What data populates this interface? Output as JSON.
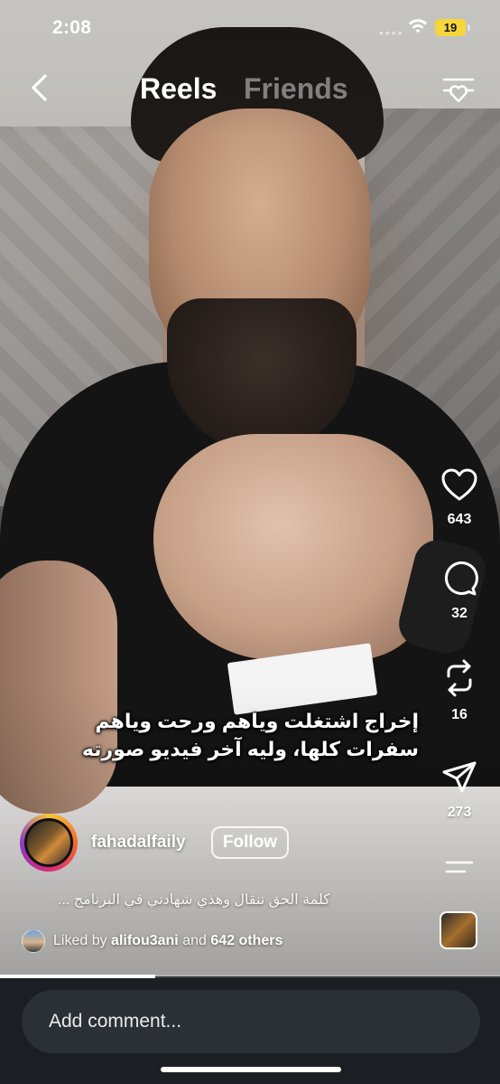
{
  "status_bar": {
    "time": "2:08",
    "battery": "19"
  },
  "header": {
    "tabs": [
      "Reels",
      "Friends"
    ],
    "active_tab": "Reels"
  },
  "actions": {
    "likes": "643",
    "comments": "32",
    "reposts": "16",
    "shares": "273"
  },
  "video": {
    "overlay_line1": "إخراج اشتغلت وياهم ورحت وياهم",
    "overlay_line2": "سفرات كلها، وليه آخر فيديو صورته",
    "progress_fraction": 0.31
  },
  "author": {
    "username": "fahadalfaily",
    "follow_label": "Follow"
  },
  "caption": "كلمة الحق تنقال وهذي شهادتي في البرنامج ...",
  "liked_by": {
    "prefix": "Liked by",
    "user": "alifou3ani",
    "conjunction": "and",
    "others": "642 others"
  },
  "comment_bar": {
    "placeholder": "Add comment..."
  },
  "colors": {
    "battery": "#f6d63a",
    "bottom_bar": "#1b1f24",
    "comment_field": "#2b3036"
  },
  "icons": [
    "back-icon",
    "filter-icon",
    "heart-icon",
    "comment-icon",
    "repost-icon",
    "share-icon",
    "more-icon"
  ]
}
